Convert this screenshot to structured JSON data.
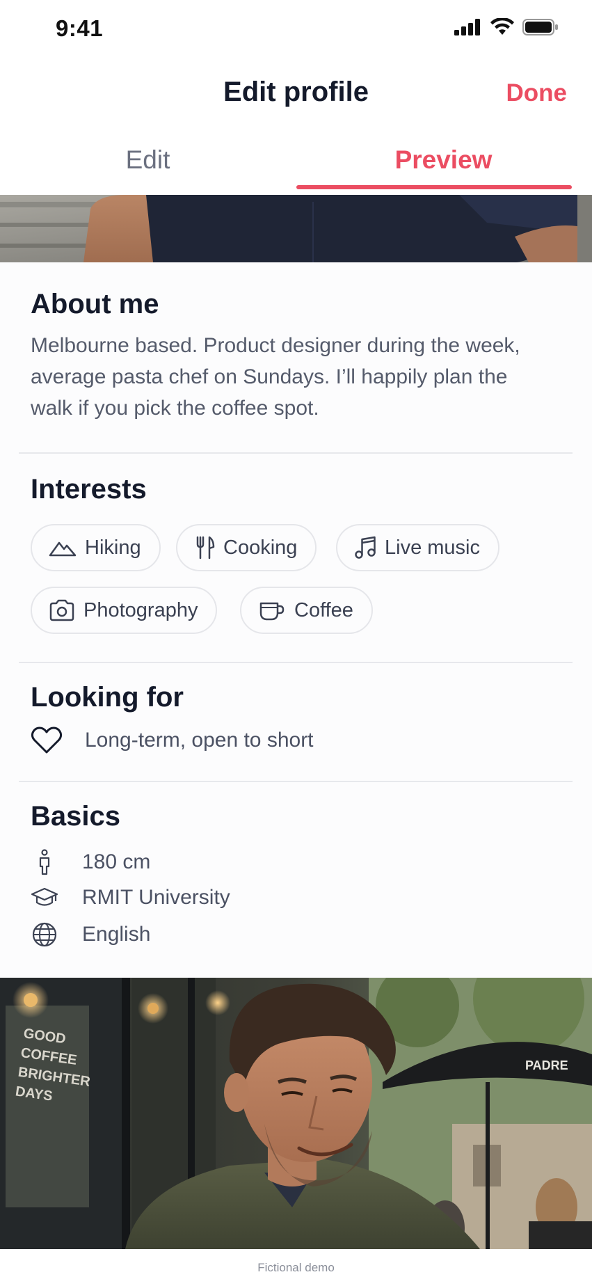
{
  "status_bar": {
    "time": "9:41"
  },
  "header": {
    "title": "Edit profile",
    "done_label": "Done"
  },
  "tabs": [
    {
      "label": "Edit",
      "active": false
    },
    {
      "label": "Preview",
      "active": true
    }
  ],
  "about": {
    "title": "About me",
    "text": "Melbourne based. Product designer during the week, average pasta chef on Sundays. I’ll happily plan the walk if you pick the coffee spot."
  },
  "interests": {
    "title": "Interests",
    "items": [
      {
        "label": "Hiking",
        "icon": "mountain-icon"
      },
      {
        "label": "Cooking",
        "icon": "utensils-icon"
      },
      {
        "label": "Live music",
        "icon": "music-note-icon"
      },
      {
        "label": "Photography",
        "icon": "camera-icon"
      },
      {
        "label": "Coffee",
        "icon": "coffee-cup-icon"
      }
    ]
  },
  "looking_for": {
    "title": "Looking for",
    "value": "Long-term, open to short",
    "icon": "heart-icon"
  },
  "basics": {
    "title": "Basics",
    "items": [
      {
        "label": "180 cm",
        "icon": "person-height-icon"
      },
      {
        "label": "RMIT University",
        "icon": "graduation-cap-icon"
      },
      {
        "label": "English",
        "icon": "globe-icon"
      }
    ]
  },
  "photo_sign": {
    "window_text": [
      "GOOD",
      "COFFEE",
      "BRIGHTER",
      "DAYS"
    ],
    "umbrella_text": "PADRE"
  },
  "footer": {
    "text": "Fictional demo"
  },
  "colors": {
    "accent": "#eb4d62",
    "text_primary": "#141a2b",
    "text_secondary": "#555b6b"
  }
}
